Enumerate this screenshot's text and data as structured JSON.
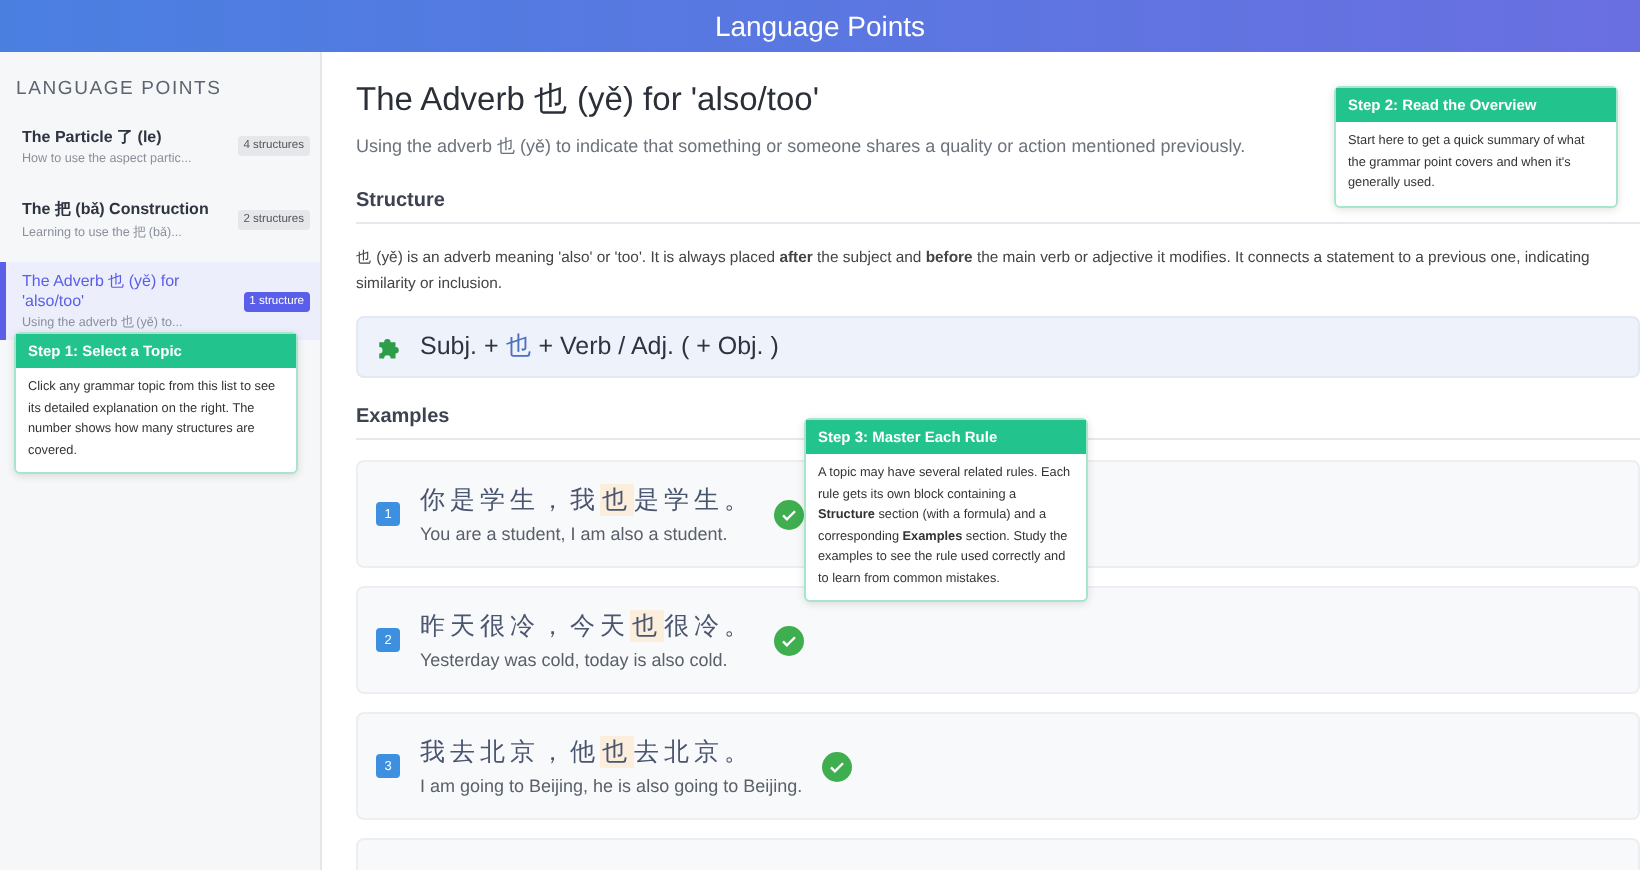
{
  "header": {
    "title": "Language Points"
  },
  "sidebar": {
    "heading": "LANGUAGE POINTS",
    "items": [
      {
        "title": "The Particle 了 (le)",
        "subtitle": "How to use the aspect partic...",
        "badge": "4 structures",
        "selected": false
      },
      {
        "title": "The 把 (bǎ) Construction",
        "subtitle": "Learning to use the 把 (bǎ)...",
        "badge": "2 structures",
        "selected": false
      },
      {
        "title": "The Adverb 也 (yě) for 'also/too'",
        "subtitle": "Using the adverb 也 (yě) to...",
        "badge": "1 structure",
        "selected": true
      }
    ]
  },
  "main": {
    "title": "The Adverb 也 (yě) for 'also/too'",
    "subtitle": "Using the adverb 也 (yě) to indicate that something or someone shares a quality or action mentioned previously.",
    "structure_heading": "Structure",
    "structure_text": "也 (yě) is an adverb meaning 'also' or 'too'. It is always placed **after** the subject and **before** the main verb or adjective it modifies. It connects a statement to a previous one, indicating similarity or inclusion.",
    "formula": {
      "before": "Subj. + ",
      "key": "也",
      "after": " + Verb / Adj. ( + Obj. )"
    },
    "examples_heading": "Examples",
    "examples": [
      {
        "number": "1",
        "zh_before": "你是学生，我",
        "zh_key": "也",
        "zh_after": "是学生。",
        "en": "You are a student, I am also a student.",
        "correct": true
      },
      {
        "number": "2",
        "zh_before": "昨天很冷，今天",
        "zh_key": "也",
        "zh_after": "很冷。",
        "en": "Yesterday was cold, today is also cold.",
        "correct": true
      },
      {
        "number": "3",
        "zh_before": "我去北京，他",
        "zh_key": "也",
        "zh_after": "去北京。",
        "en": "I am going to Beijing, he is also going to Beijing.",
        "correct": true
      }
    ]
  },
  "tooltips": [
    {
      "title": "Step 1: Select a Topic",
      "text": "Click any grammar topic from this list to see its detailed explanation on the right. The number shows how many structures are covered."
    },
    {
      "title": "Step 2: Read the Overview",
      "text": "Start here to get a quick summary of what the grammar point covers and when it's generally used."
    },
    {
      "title": "Step 3: Master Each Rule",
      "text": "A topic may have several related rules. Each rule gets its own block containing a **Structure** section (with a formula) and a corresponding **Examples** section. Study the examples to see the rule used correctly and to learn from common mistakes."
    }
  ]
}
